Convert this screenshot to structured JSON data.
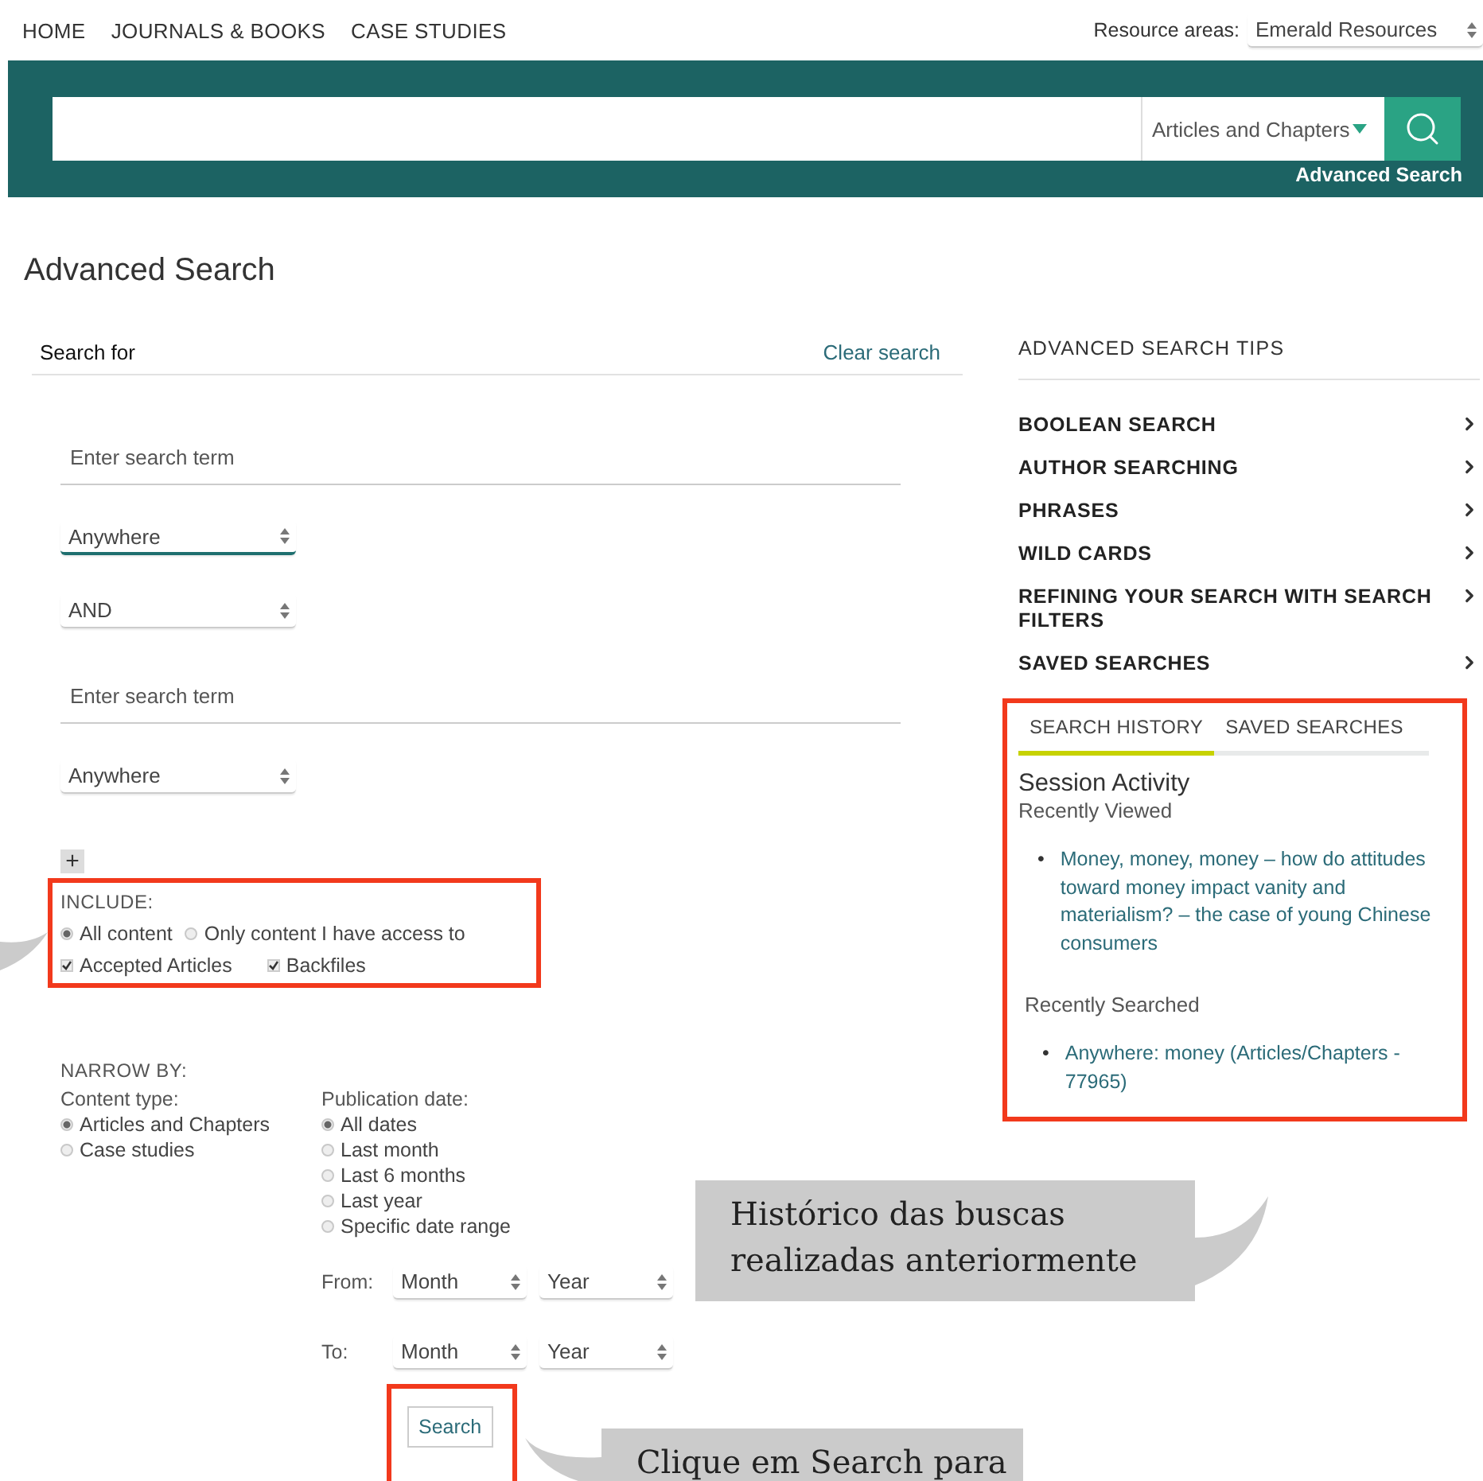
{
  "top_nav": {
    "links": [
      "HOME",
      "JOURNALS & BOOKS",
      "CASE STUDIES"
    ],
    "resource_areas": {
      "label": "Resource areas:",
      "value": "Emerald Resources"
    }
  },
  "banner": {
    "content_type": "Articles and Chapters",
    "advanced_search_link": "Advanced Search"
  },
  "page_title": "Advanced Search",
  "search_form": {
    "heading": "Search for",
    "clear_link": "Clear search",
    "rows": [
      {
        "kind": "term",
        "placeholder": "Enter search term"
      },
      {
        "kind": "select",
        "value": "Anywhere",
        "focused": true
      },
      {
        "kind": "select",
        "value": "AND",
        "focused": false
      },
      {
        "kind": "term",
        "placeholder": "Enter search term"
      },
      {
        "kind": "select",
        "value": "Anywhere",
        "focused": false
      }
    ],
    "add_button": "+",
    "include": {
      "label": "INCLUDE:",
      "highlighted": true,
      "options": [
        {
          "label": "All content",
          "selected": true
        },
        {
          "label": "Only content I have access to",
          "selected": false
        }
      ],
      "checkboxes": [
        {
          "label": "Accepted Articles",
          "checked": true
        },
        {
          "label": "Backfiles",
          "checked": true
        }
      ]
    },
    "narrow_by": {
      "label": "NARROW BY:",
      "content_type": {
        "label": "Content type:",
        "options": [
          {
            "label": "Articles and Chapters",
            "selected": true
          },
          {
            "label": "Case studies",
            "selected": false
          }
        ]
      },
      "publication_date": {
        "label": "Publication date:",
        "options": [
          {
            "label": "All dates",
            "selected": true
          },
          {
            "label": "Last month",
            "selected": false
          },
          {
            "label": "Last 6 months",
            "selected": false
          },
          {
            "label": "Last year",
            "selected": false
          },
          {
            "label": "Specific date range",
            "selected": false
          }
        ]
      },
      "date_range": [
        {
          "label": "From:",
          "month": "Month",
          "year": "Year"
        },
        {
          "label": "To:",
          "month": "Month",
          "year": "Year"
        }
      ]
    },
    "search_button": {
      "label": "Search",
      "highlighted": true
    }
  },
  "tips": {
    "title": "ADVANCED SEARCH TIPS",
    "items": [
      "BOOLEAN SEARCH",
      "AUTHOR SEARCHING",
      "PHRASES",
      "WILD CARDS",
      "REFINING YOUR SEARCH WITH SEARCH FILTERS",
      "SAVED SEARCHES"
    ]
  },
  "history_panel": {
    "highlighted": true,
    "tabs": [
      {
        "label": "SEARCH HISTORY",
        "selected": true
      },
      {
        "label": "SAVED SEARCHES",
        "selected": false
      }
    ],
    "heading": "Session Activity",
    "bullet": "•",
    "sections": [
      {
        "title": "Recently Viewed",
        "items": [
          "Money, money, money – how do attitudes toward money impact vanity and materialism? – the case of young Chinese consumers"
        ]
      },
      {
        "title": "Recently Searched",
        "items": [
          "Anywhere: money (Articles/Chapters - 77965)"
        ]
      }
    ]
  },
  "callouts": [
    {
      "text": "Histórico das buscas realizadas anteriormente"
    },
    {
      "text": "Clique em Search para"
    }
  ]
}
